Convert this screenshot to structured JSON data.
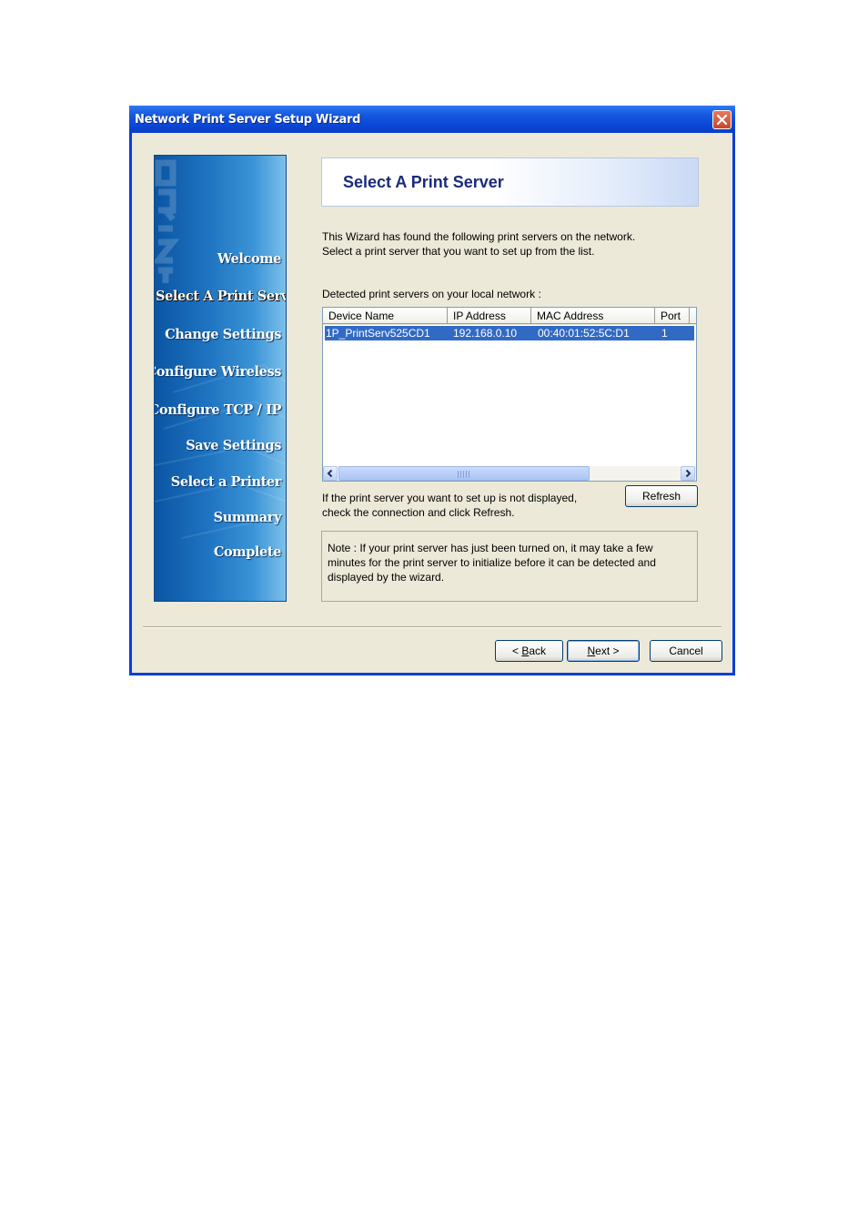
{
  "window": {
    "title": "Network Print Server Setup Wizard"
  },
  "sidebar": {
    "watermark": "PRINT",
    "items": [
      {
        "label": "Welcome"
      },
      {
        "label": "Select A Print Server",
        "active": true
      },
      {
        "label": "Change Settings"
      },
      {
        "label": "Configure Wireless"
      },
      {
        "label": "Configure TCP / IP"
      },
      {
        "label": "Save Settings"
      },
      {
        "label": "Select a Printer"
      },
      {
        "label": "Summary"
      },
      {
        "label": "Complete"
      }
    ]
  },
  "header": {
    "title": "Select A Print Server"
  },
  "intro": {
    "line1": "This Wizard has found the following print servers on the network.",
    "line2": "Select a print server that you want to set up from the list."
  },
  "list": {
    "caption": "Detected print servers on your local network :",
    "columns": [
      "Device Name",
      "IP Address",
      "MAC Address",
      "Port"
    ],
    "rows": [
      [
        "1P_PrintServ525CD1",
        "192.168.0.10",
        "00:40:01:52:5C:D1",
        "1"
      ]
    ],
    "selected_row": 0
  },
  "hint": {
    "line1": "If the print server you want to set up is not displayed,",
    "line2": "check the connection and click Refresh."
  },
  "buttons": {
    "refresh": "Refresh",
    "back_prefix": "< ",
    "back_key": "B",
    "back_rest": "ack",
    "next_key": "N",
    "next_rest": "ext >",
    "cancel": "Cancel"
  },
  "note": {
    "line1": "Note : If your print server has just been turned on, it may take a few",
    "line2": "minutes for the print server to initialize before it can be detected and",
    "line3": "displayed by the wizard."
  },
  "colors": {
    "titlebar": "#0a3fd8",
    "dialog_bg": "#ece9d8",
    "selection": "#316ac5",
    "header_title": "#1b2b78"
  }
}
